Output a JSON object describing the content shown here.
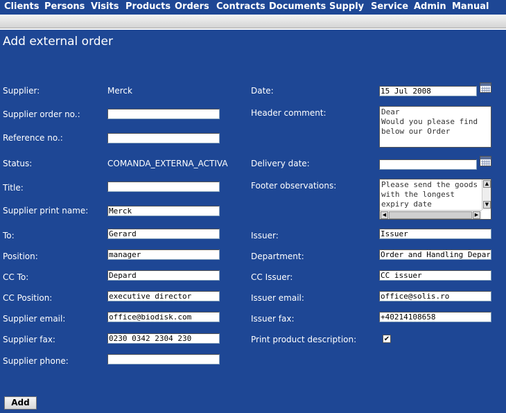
{
  "nav": {
    "items": [
      {
        "label": "Clients"
      },
      {
        "label": "Persons"
      },
      {
        "label": "Visits"
      },
      {
        "label": "Products"
      },
      {
        "label": "Orders"
      },
      {
        "label": "Contracts"
      },
      {
        "label": "Documents"
      },
      {
        "label": "Supply"
      },
      {
        "label": "Service"
      },
      {
        "label": "Admin"
      },
      {
        "label": "Manual"
      }
    ]
  },
  "page": {
    "title": "Add external order"
  },
  "form": {
    "left": {
      "supplier": {
        "label": "Supplier:",
        "value": "Merck"
      },
      "supplier_order_no": {
        "label": "Supplier order no.:",
        "value": ""
      },
      "reference_no": {
        "label": "Reference no.:",
        "value": ""
      },
      "status": {
        "label": "Status:",
        "value": "COMANDA_EXTERNA_ACTIVA"
      },
      "title": {
        "label": "Title:",
        "value": ""
      },
      "supplier_print_name": {
        "label": "Supplier print name:",
        "value": "Merck"
      },
      "to": {
        "label": "To:",
        "value": "Gerard"
      },
      "position": {
        "label": "Position:",
        "value": "manager"
      },
      "cc_to": {
        "label": "CC To:",
        "value": "Depard"
      },
      "cc_position": {
        "label": "CC Position:",
        "value": "executive director"
      },
      "supplier_email": {
        "label": "Supplier email:",
        "value": "office@biodisk.com"
      },
      "supplier_fax": {
        "label": "Supplier fax:",
        "value": "0230 0342 2304 230"
      },
      "supplier_phone": {
        "label": "Supplier phone:",
        "value": ""
      }
    },
    "right": {
      "date": {
        "label": "Date:",
        "value": "15 Jul 2008"
      },
      "header_comment": {
        "label": "Header comment:",
        "value": "Dear\nWould you please find below our Order"
      },
      "delivery_date": {
        "label": "Delivery date:",
        "value": ""
      },
      "footer_observations": {
        "label": "Footer observations:",
        "value": "Please send the goods with the longest expiry date"
      },
      "issuer": {
        "label": "Issuer:",
        "value": "Issuer"
      },
      "department": {
        "label": "Department:",
        "value": "Order and Handling Departm"
      },
      "cc_issuer": {
        "label": "CC Issuer:",
        "value": "CC issuer"
      },
      "issuer_email": {
        "label": "Issuer email:",
        "value": "office@solis.ro"
      },
      "issuer_fax": {
        "label": "Issuer fax:",
        "value": "+40214108658"
      },
      "print_product_description": {
        "label": "Print product description:",
        "checked": true,
        "mark": "✔"
      }
    }
  },
  "actions": {
    "add_label": "Add"
  },
  "colors": {
    "background": "#1e4795",
    "text": "#ffffff",
    "field": "#ffffff"
  },
  "icons": {
    "date_picker": "calendar-icon",
    "delivery_picker": "calendar-icon"
  }
}
